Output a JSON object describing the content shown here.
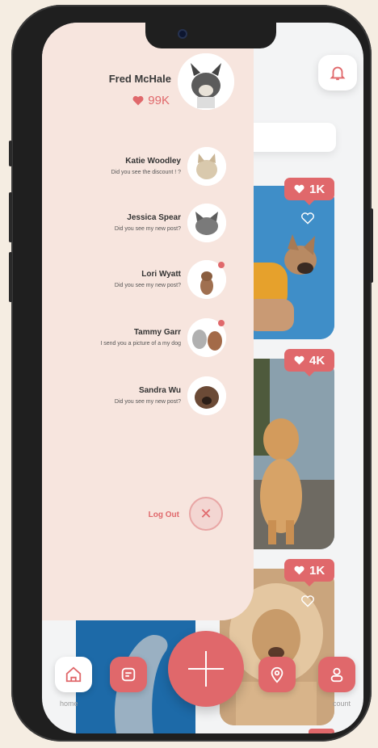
{
  "profile": {
    "name": "Fred McHale",
    "likes": "99K"
  },
  "messages": [
    {
      "name": "Katie Woodley",
      "text": "Did you see the discount  !  ?",
      "unread": false
    },
    {
      "name": "Jessica Spear",
      "text": "Did you see my new post?",
      "unread": false
    },
    {
      "name": "Lori Wyatt",
      "text": "Did you see my new post?",
      "unread": true
    },
    {
      "name": "Tammy Garr",
      "text": "I send you a picture of a my dog",
      "unread": true
    },
    {
      "name": "Sandra Wu",
      "text": "Did you see my new post?",
      "unread": false
    }
  ],
  "logout_label": "Log Out",
  "feed": [
    {
      "likes": "1K"
    },
    {
      "likes": "4K"
    },
    {
      "likes": "1K"
    }
  ],
  "nav": {
    "home_label": "home",
    "account_label": "count"
  },
  "colors": {
    "accent": "#e0686b",
    "drawer": "#f7e5de",
    "background": "#f5ede2"
  },
  "icons": [
    "bell-icon",
    "heart-icon",
    "close-icon",
    "home-icon",
    "message-icon",
    "plus-icon",
    "location-icon",
    "account-icon"
  ]
}
